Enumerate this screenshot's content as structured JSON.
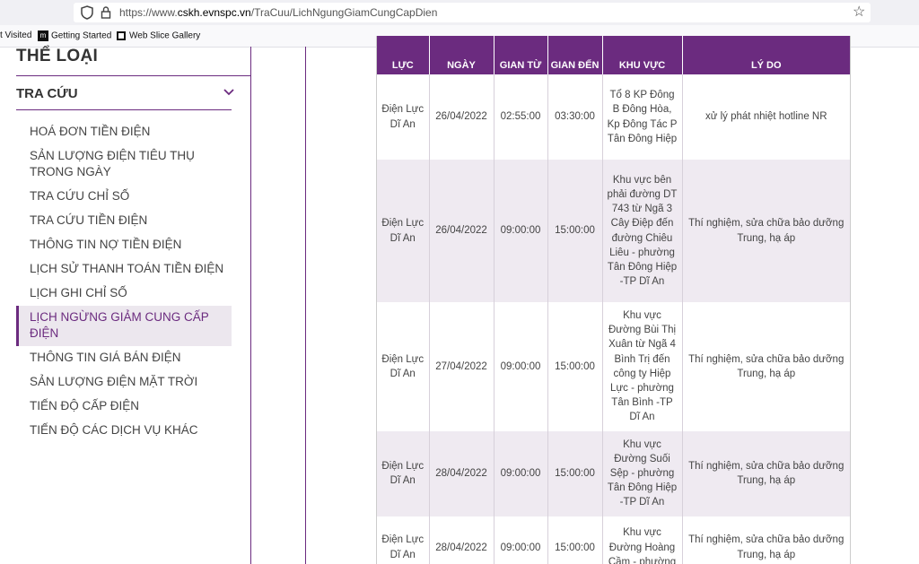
{
  "browser": {
    "url_prefix": "https://www.",
    "url_domain": "cskh.evnspc.vn",
    "url_path": "/TraCuu/LichNgungGiamCungCapDien",
    "bookmarks": [
      "t Visited",
      "Getting Started",
      "Web Slice Gallery"
    ]
  },
  "sidebar": {
    "category_title": "THỂ LOẠI",
    "section_title": "TRA CỨU",
    "items": [
      "HOÁ ĐƠN TIỀN ĐIỆN",
      "SẢN LƯỢNG ĐIỆN TIÊU THỤ TRONG NGÀY",
      "TRA CỨU CHỈ SỐ",
      "TRA CỨU TIỀN ĐIỆN",
      "THÔNG TIN NỢ TIỀN ĐIỆN",
      "LỊCH SỬ THANH TOÁN TIỀN ĐIỆN",
      "LỊCH GHI CHỈ SỐ",
      "LỊCH NGỪNG GIẢM CUNG CẤP ĐIỆN",
      "THÔNG TIN GIÁ BÁN ĐIỆN",
      "SẢN LƯỢNG ĐIỆN MẶT TRỜI",
      "TIẾN ĐỘ CẤP ĐIỆN",
      "TIẾN ĐỘ CÁC DỊCH VỤ KHÁC"
    ],
    "active_index": 7
  },
  "table": {
    "headers": [
      "LỰC",
      "NGÀY",
      "GIAN TỪ",
      "GIAN ĐẾN",
      "KHU VỰC",
      "LÝ DO"
    ],
    "rows": [
      {
        "dl": "Điện Lực Dĩ An",
        "date": "26/04/2022",
        "from": "02:55:00",
        "to": "03:30:00",
        "area": "Tổ 8 KP Đông B Đông Hòa, Kp Đông Tác P Tân Đông Hiệp",
        "reason": "xử lý phát nhiệt hotline NR"
      },
      {
        "dl": "Điện Lực Dĩ An",
        "date": "26/04/2022",
        "from": "09:00:00",
        "to": "15:00:00",
        "area": "Khu vực bên phải đường DT 743 từ Ngã 3 Cây Điệp đến đường Chiêu Liêu - phường Tân Đông Hiệp -TP Dĩ An",
        "reason": "Thí nghiệm, sửa chữa bảo dưỡng Trung, hạ áp"
      },
      {
        "dl": "Điện Lực Dĩ An",
        "date": "27/04/2022",
        "from": "09:00:00",
        "to": "15:00:00",
        "area": "Khu vực Đường Bùi Thị Xuân từ Ngã 4 Bình Trị đến công ty Hiệp Lực - phường Tân Bình -TP Dĩ An",
        "reason": "Thí nghiệm, sửa chữa bảo dưỡng Trung, hạ áp"
      },
      {
        "dl": "Điện Lực Dĩ An",
        "date": "28/04/2022",
        "from": "09:00:00",
        "to": "15:00:00",
        "area": "Khu vực Đường Suối Sệp - phường Tân Đông Hiệp -TP Dĩ An",
        "reason": "Thí nghiệm, sửa chữa bảo dưỡng Trung, hạ áp"
      },
      {
        "dl": "Điện Lực Dĩ An",
        "date": "28/04/2022",
        "from": "09:00:00",
        "to": "15:00:00",
        "area": "Khu vực Đường Hoàng Cầm - phường",
        "reason": "Thí nghiệm, sửa chữa bảo dưỡng Trung, hạ áp"
      }
    ]
  },
  "colors": {
    "accent": "#6b2b7f",
    "row_alt": "#efeaf1"
  }
}
